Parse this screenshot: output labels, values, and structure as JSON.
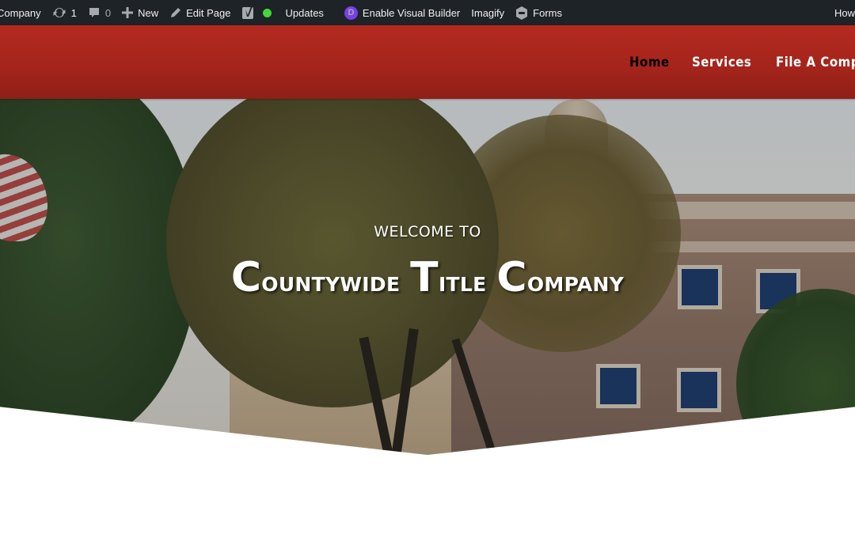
{
  "adminbar": {
    "site_name": "Company",
    "updates_count": "1",
    "comments_count": "0",
    "new_label": "New",
    "edit_page_label": "Edit Page",
    "updates_label": "Updates",
    "divi_letter": "D",
    "visual_builder_label": "Enable Visual Builder",
    "imagify_label": "Imagify",
    "forms_label": "Forms",
    "howdy_label": "How"
  },
  "nav": {
    "items": [
      {
        "label": "Home",
        "active": true
      },
      {
        "label": "Services",
        "active": false
      },
      {
        "label": "File A Complai",
        "active": false
      }
    ]
  },
  "hero": {
    "welcome": "WELCOME TO",
    "title_words": [
      {
        "cap": "C",
        "rest": "ountywide"
      },
      {
        "cap": "T",
        "rest": "itle"
      },
      {
        "cap": "C",
        "rest": "ompany"
      }
    ]
  },
  "colors": {
    "adminbar_bg": "#1d2327",
    "header_red": "#a3241b",
    "nav_active": "#000000",
    "nav_text": "#ffffff",
    "status_green": "#46d43c",
    "divi_purple": "#7b3fe4"
  }
}
